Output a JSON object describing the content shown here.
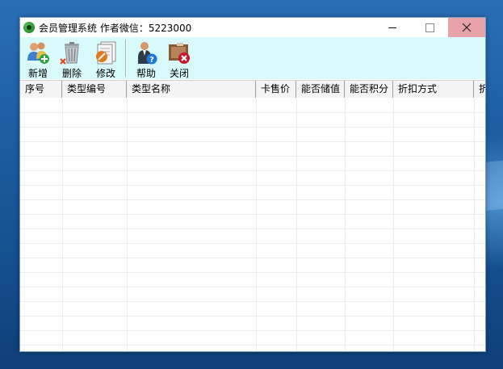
{
  "window": {
    "title": "会员管理系统  作者微信：5223000",
    "controls": {
      "minimize": "minimize-icon",
      "maximize": "maximize-icon",
      "close": "close-icon"
    }
  },
  "toolbar": {
    "add_label": "新增",
    "delete_label": "删除",
    "edit_label": "修改",
    "help_label": "帮助",
    "close_label": "关闭"
  },
  "grid": {
    "columns": [
      "序号",
      "类型编号",
      "类型名称",
      "卡售价",
      "能否储值",
      "能否积分",
      "折扣方式",
      "折"
    ],
    "rows": []
  },
  "colors": {
    "toolbar_bg": "#d8fafb",
    "close_hover": "#e8a3a8",
    "header_bg": "#f4f4f4"
  }
}
